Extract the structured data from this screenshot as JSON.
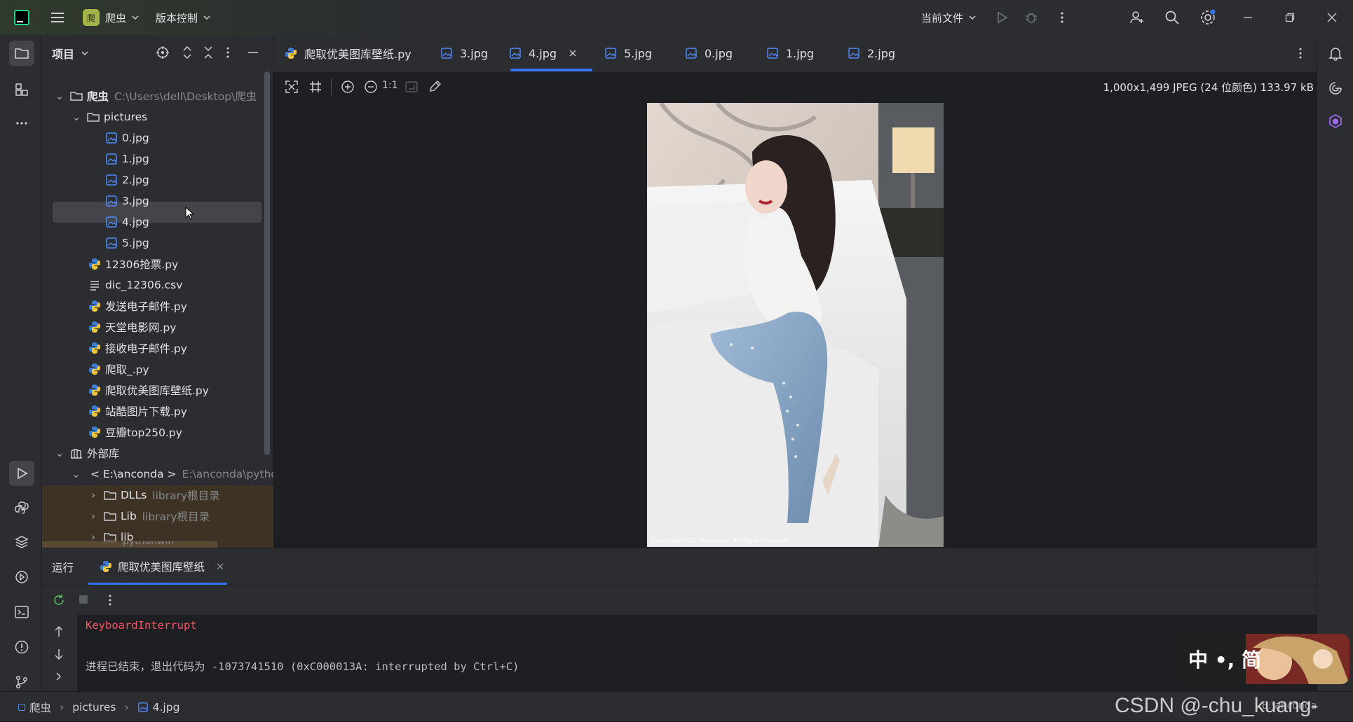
{
  "titlebar": {
    "project_name": "爬虫",
    "project_badge": "爬",
    "vcs_label": "版本控制",
    "run_config": "当前文件"
  },
  "project_panel": {
    "title": "项目",
    "tree": {
      "root_name": "爬虫",
      "root_path": "C:\\Users\\dell\\Desktop\\爬虫",
      "pictures_folder": "pictures",
      "images": [
        "0.jpg",
        "1.jpg",
        "2.jpg",
        "3.jpg",
        "4.jpg",
        "5.jpg"
      ],
      "files": [
        "12306抢票.py",
        "dic_12306.csv",
        "发送电子邮件.py",
        "天堂电影网.py",
        "接收电子邮件.py",
        "爬取_.py",
        "爬取优美图库壁纸.py",
        "站酷图片下载.py",
        "豆瓣top250.py"
      ],
      "external_libs": "外部库",
      "sdk_name": "< E:\\anconda >",
      "sdk_path": "E:\\anconda\\python.exe",
      "lib_entries": [
        {
          "name": "DLLs",
          "hint": "library根目录"
        },
        {
          "name": "Lib",
          "hint": "library根目录"
        },
        {
          "name": "lib",
          "hint": ""
        }
      ],
      "partial_entry": "pythonwin"
    }
  },
  "editor": {
    "tabs": [
      "爬取优美图库壁纸.py",
      "3.jpg",
      "4.jpg",
      "5.jpg",
      "0.jpg",
      "1.jpg",
      "2.jpg"
    ],
    "active_tab": "4.jpg",
    "image_info": "1,000x1,499 JPEG (24 位颜色) 133.97 kB",
    "zoom_label": "1:1",
    "photo_watermark": "Copyright©2021 xiuren.com. All Rights Reserved"
  },
  "run_panel": {
    "title": "运行",
    "run_tab": "爬取优美图库壁纸",
    "console_lines": [
      {
        "text": "KeyboardInterrupt",
        "color": "#f75464"
      },
      {
        "text": "",
        "color": "#bcbec4"
      },
      {
        "text": "进程已结束，退出代码为 -1073741510 (0xC000013A: interrupted by Ctrl+C)",
        "color": "#bcbec4"
      }
    ]
  },
  "statusbar": {
    "crumbs": [
      "爬虫",
      "pictures",
      "4.jpg"
    ],
    "right_fragment": "E:\\anconda",
    "watermark": "CSDN @-chu_kuang-",
    "ime": "中 •, 简"
  },
  "colors": {
    "accent": "#3574f0",
    "panel_bg": "#2b2d30",
    "editor_bg": "#1e1f22",
    "selected_row": "#43454a",
    "error_text": "#f75464",
    "library_bg": "#3d3223"
  }
}
